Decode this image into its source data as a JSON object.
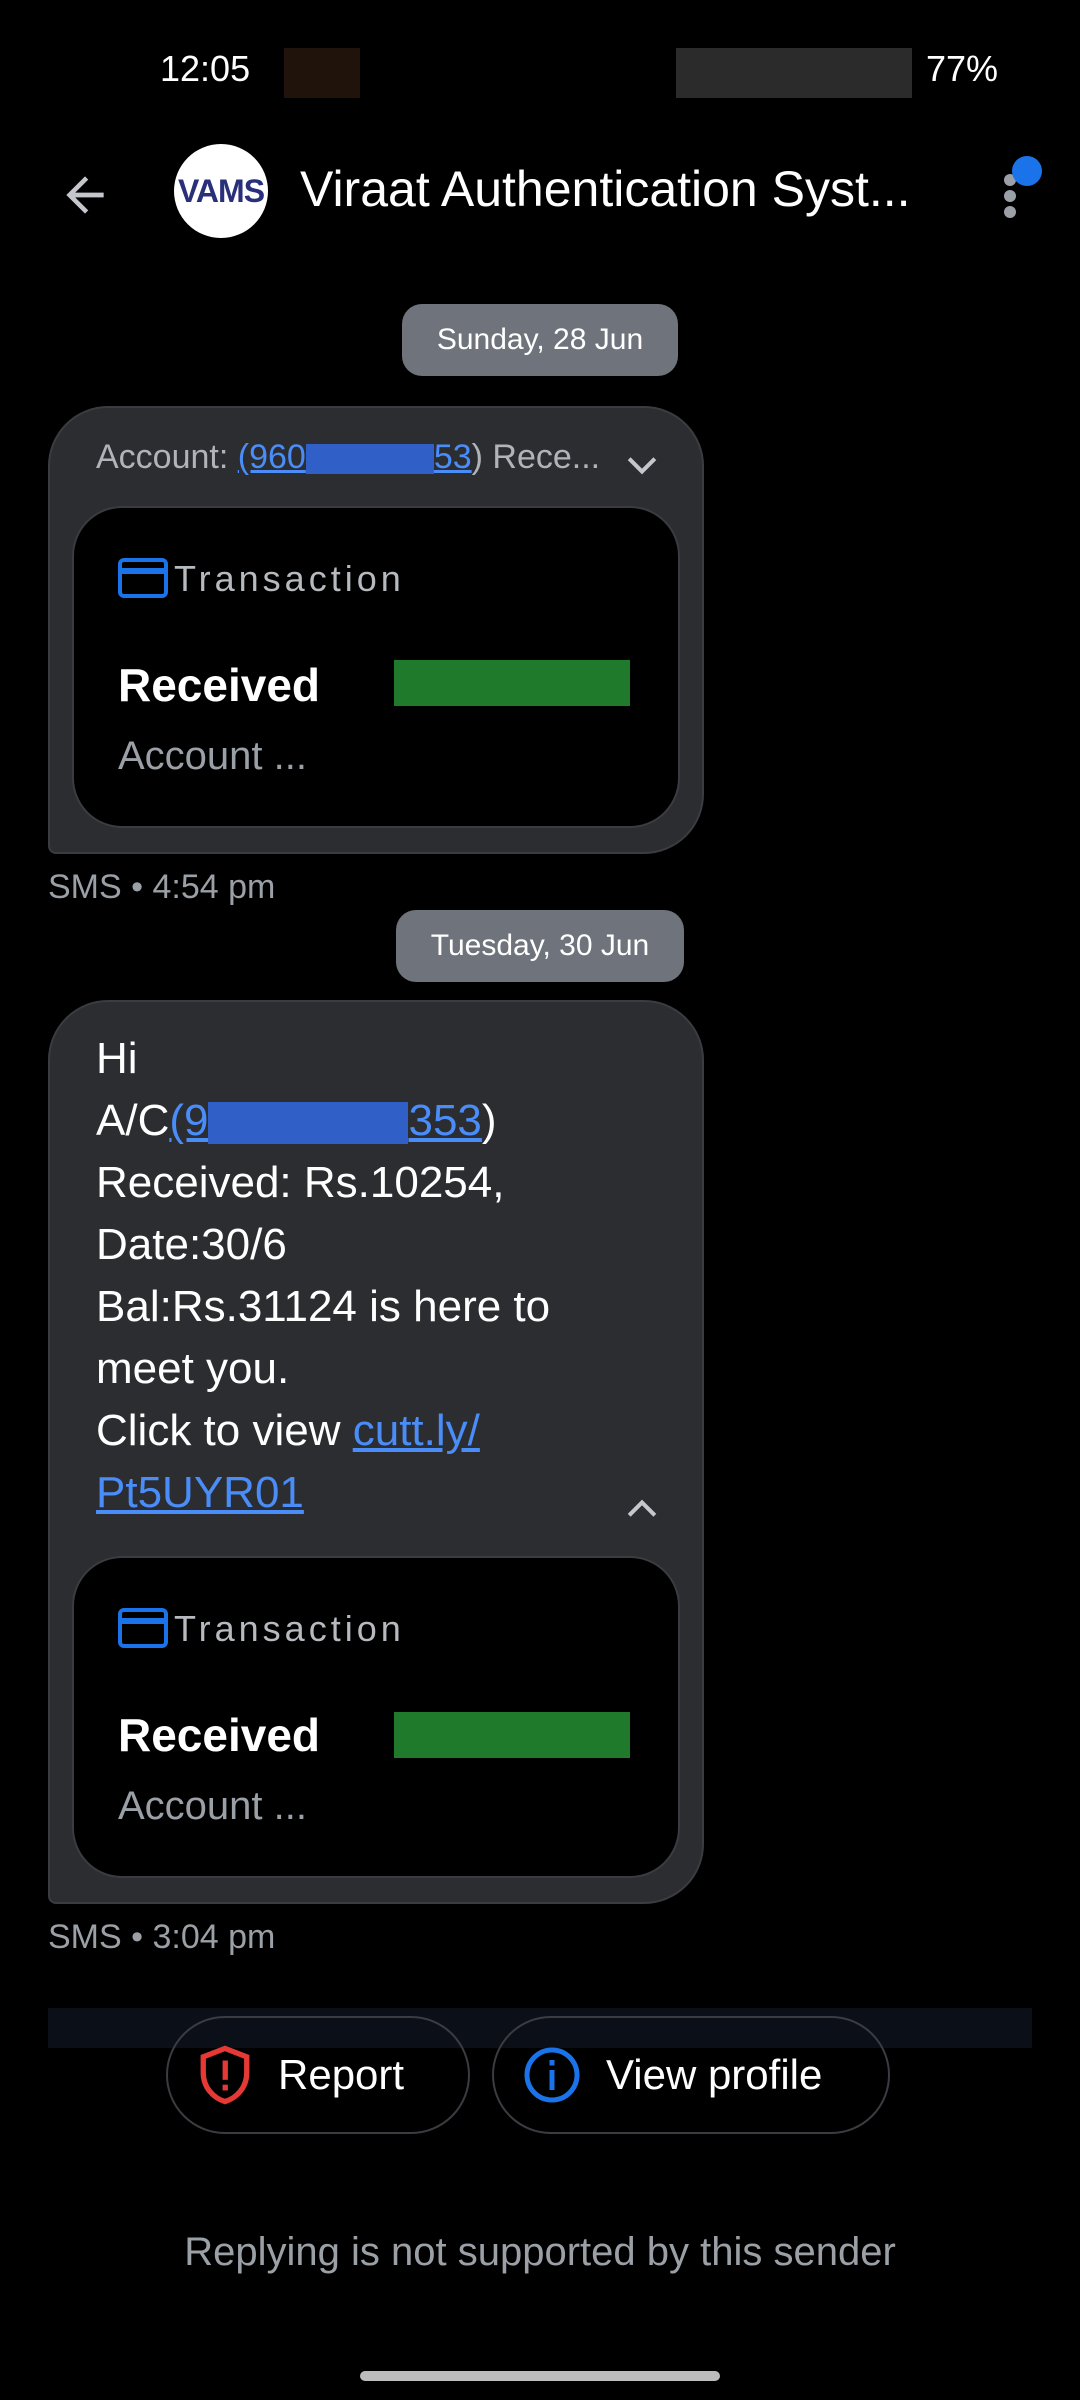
{
  "status_bar": {
    "time": "12:05",
    "battery": "77%"
  },
  "header": {
    "title": "Viraat Authentication Syst...",
    "avatar_text": "VAMS",
    "back_icon": "arrow-left-icon",
    "menu_icon": "more-vert-icon"
  },
  "messages": [
    {
      "date": "Sunday, 28 Jun",
      "header_prefix": "Account: ",
      "header_link_start": "(960",
      "header_link_end": "53",
      "header_suffix": ") Rece...",
      "card": {
        "label": "Transaction",
        "received": "Received",
        "account": "Account ..."
      },
      "meta": "SMS • 4:54 pm"
    },
    {
      "date": "Tuesday, 30 Jun",
      "line1": "Hi",
      "ac_prefix": "A/C",
      "ac_link_start": "(9",
      "ac_link_end": "353",
      "ac_suffix": ")",
      "line3": "Received: Rs.10254,",
      "line4": "Date:30/6",
      "line5": "Bal:Rs.31124 is here to",
      "line6": "meet you.",
      "line7_prefix": "Click to view ",
      "link_part1": "cutt.ly/",
      "link_part2": "Pt5UYR01",
      "card": {
        "label": "Transaction",
        "received": "Received",
        "account": "Account ..."
      },
      "meta": "SMS • 3:04 pm"
    }
  ],
  "actions": {
    "report": "Report",
    "view_profile": "View profile"
  },
  "footer": {
    "reply_note": "Replying is not supported by this sender"
  },
  "colors": {
    "accent": "#1a73e8",
    "link": "#4a8df8",
    "report_red": "#e53935",
    "bubble": "#2b2d31"
  }
}
